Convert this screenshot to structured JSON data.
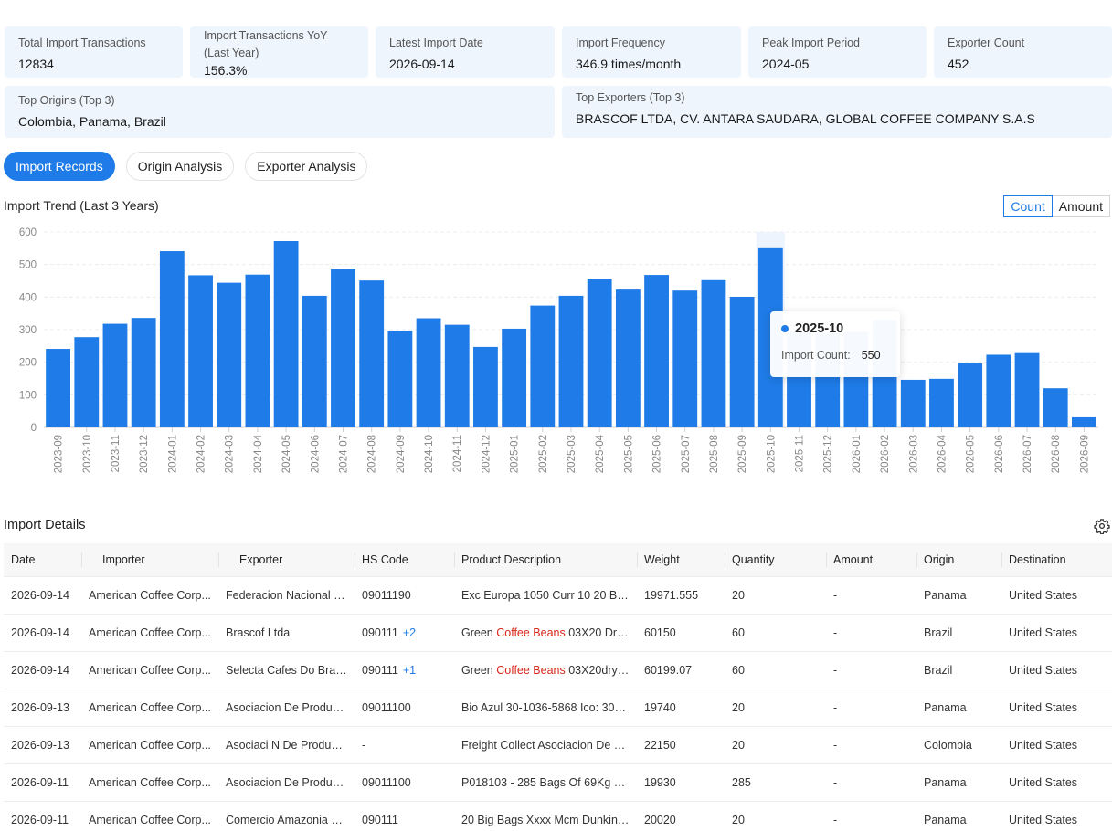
{
  "stats": [
    {
      "label": "Total Import Transactions",
      "value": "12834"
    },
    {
      "label": "Import Transactions YoY (Last Year)",
      "value": "156.3%"
    },
    {
      "label": "Latest Import Date",
      "value": "2026-09-14"
    },
    {
      "label": "Import Frequency",
      "value": "346.9 times/month"
    },
    {
      "label": "Peak Import Period",
      "value": "2024-05"
    },
    {
      "label": "Exporter Count",
      "value": "452"
    },
    {
      "label": "Top Origins (Top 3)",
      "value": "Colombia, Panama, Brazil"
    },
    {
      "label": "Top Exporters (Top 3)",
      "value": "BRASCOF LTDA, CV. ANTARA SAUDARA, GLOBAL COFFEE COMPANY S.A.S"
    }
  ],
  "tabs": [
    "Import Records",
    "Origin Analysis",
    "Exporter Analysis"
  ],
  "trend": {
    "title": "Import Trend (Last 3 Years)",
    "toggle": [
      "Count",
      "Amount"
    ]
  },
  "chart_data": {
    "type": "bar",
    "categories": [
      "2023-09",
      "2023-10",
      "2023-11",
      "2023-12",
      "2024-01",
      "2024-02",
      "2024-03",
      "2024-04",
      "2024-05",
      "2024-06",
      "2024-07",
      "2024-08",
      "2024-09",
      "2024-10",
      "2024-11",
      "2024-12",
      "2025-01",
      "2025-02",
      "2025-03",
      "2025-04",
      "2025-05",
      "2025-06",
      "2025-07",
      "2025-08",
      "2025-09",
      "2025-10",
      "2025-11",
      "2025-12",
      "2026-01",
      "2026-02",
      "2026-03",
      "2026-04",
      "2026-05",
      "2026-06",
      "2026-07",
      "2026-08",
      "2026-09"
    ],
    "values": [
      241,
      277,
      318,
      336,
      541,
      467,
      444,
      469,
      572,
      404,
      485,
      451,
      296,
      335,
      315,
      247,
      303,
      374,
      404,
      457,
      423,
      468,
      420,
      452,
      401,
      550,
      295,
      290,
      293,
      330,
      146,
      149,
      197,
      223,
      228,
      120,
      31
    ],
    "ylim": [
      0,
      600
    ],
    "yticks": [
      0,
      100,
      200,
      300,
      400,
      500,
      600
    ],
    "color": "#1e7be7",
    "grid": true,
    "highlight_index": 25
  },
  "tooltip": {
    "period": "2025-10",
    "label": "Import Count:",
    "value": "550"
  },
  "details": {
    "title": "Import Details",
    "columns": [
      "Date",
      "Importer",
      "Exporter",
      "HS Code",
      "Product Description",
      "Weight",
      "Quantity",
      "Amount",
      "Origin",
      "Destination"
    ],
    "rows": [
      {
        "date": "2026-09-14",
        "importer": "American Coffee Corp...",
        "exporter": "Federacion Nacional D...",
        "hs": "09011190",
        "hs_more": "",
        "desc_pre": "Exc Europa 1050 Curr 10 20 Big ...",
        "desc_hl": "",
        "desc_post": "",
        "weight": "19971.555",
        "qty": "20",
        "amount": "-",
        "origin": "Panama",
        "dest": "United States"
      },
      {
        "date": "2026-09-14",
        "importer": "American Coffee Corp...",
        "exporter": "Brascof Ltda",
        "hs": "090111",
        "hs_more": "+2",
        "desc_pre": "Green ",
        "desc_hl": "Coffee Beans",
        "desc_post": " 03X20 Dry (T...",
        "weight": "60150",
        "qty": "60",
        "amount": "-",
        "origin": "Brazil",
        "dest": "United States"
      },
      {
        "date": "2026-09-14",
        "importer": "American Coffee Corp...",
        "exporter": "Selecta Cafes Do Brasil ...",
        "hs": "090111",
        "hs_more": "+1",
        "desc_pre": "Green ",
        "desc_hl": "Coffee Beans",
        "desc_post": " 03X20dry Co...",
        "weight": "60199.07",
        "qty": "60",
        "amount": "-",
        "origin": "Brazil",
        "dest": "United States"
      },
      {
        "date": "2026-09-13",
        "importer": "American Coffee Corp...",
        "exporter": "Asociacion De Product...",
        "hs": "09011100",
        "hs_more": "",
        "desc_pre": "Bio Azul 30-1036-5868 Ico: 30-0...",
        "desc_hl": "",
        "desc_post": "",
        "weight": "19740",
        "qty": "20",
        "amount": "-",
        "origin": "Panama",
        "dest": "United States"
      },
      {
        "date": "2026-09-13",
        "importer": "American Coffee Corp...",
        "exporter": "Asociaci N De Product...",
        "hs": "-",
        "hs_more": "",
        "desc_pre": "Freight Collect Asociacion De Xx...",
        "desc_hl": "",
        "desc_post": "",
        "weight": "22150",
        "qty": "20",
        "amount": "-",
        "origin": "Colombia",
        "dest": "United States"
      },
      {
        "date": "2026-09-11",
        "importer": "American Coffee Corp...",
        "exporter": "Asociacion De Product...",
        "hs": "09011100",
        "hs_more": "",
        "desc_pre": "P018103 - 285 Bags Of 69Kg ",
        "desc_hl": "Cof...",
        "desc_post": "",
        "weight": "19930",
        "qty": "285",
        "amount": "-",
        "origin": "Panama",
        "dest": "United States"
      },
      {
        "date": "2026-09-11",
        "importer": "American Coffee Corp...",
        "exporter": "Comercio Amazonia S.A",
        "hs": "090111",
        "hs_more": "",
        "desc_pre": "20 Big Bags Xxxx Mcm Dunkin D...",
        "desc_hl": "",
        "desc_post": "",
        "weight": "20020",
        "qty": "20",
        "amount": "-",
        "origin": "Panama",
        "dest": "United States"
      }
    ]
  }
}
